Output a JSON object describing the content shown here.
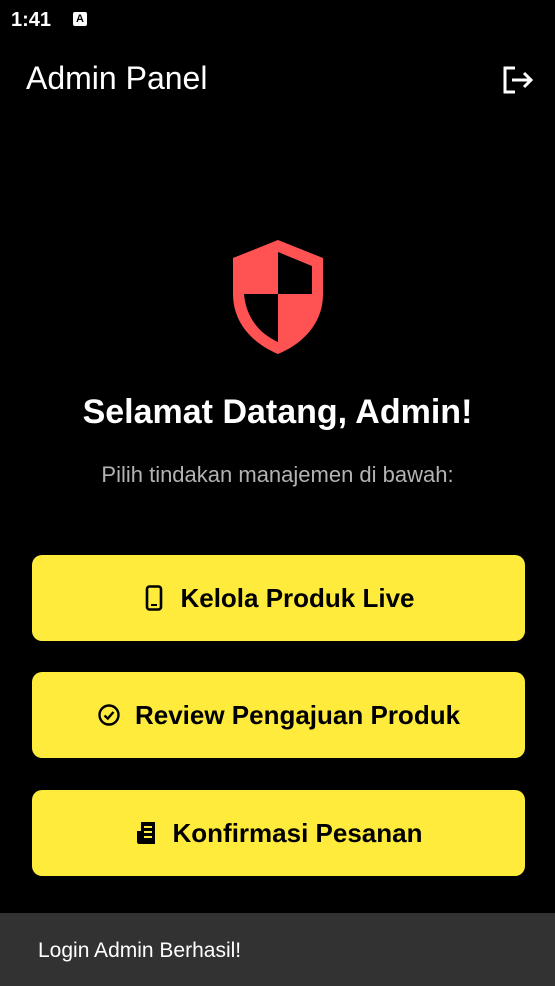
{
  "status_bar": {
    "time": "1:41",
    "app_icon_letter": "A"
  },
  "app_bar": {
    "title": "Admin Panel",
    "logout_icon": "logout-icon"
  },
  "hero": {
    "icon": "shield-icon",
    "icon_color": "#ff5252",
    "welcome": "Selamat Datang, Admin!",
    "subtitle": "Pilih tindakan manajemen di bawah:"
  },
  "actions": [
    {
      "label": "Kelola Produk Live",
      "icon": "phone-icon"
    },
    {
      "label": "Review Pengajuan Produk",
      "icon": "check-circle-icon"
    },
    {
      "label": "Konfirmasi Pesanan",
      "icon": "receipt-icon"
    }
  ],
  "colors": {
    "accent": "#ffeb3b",
    "background": "#000000",
    "snackbar": "#323232"
  },
  "snackbar": {
    "message": "Login Admin Berhasil!"
  }
}
